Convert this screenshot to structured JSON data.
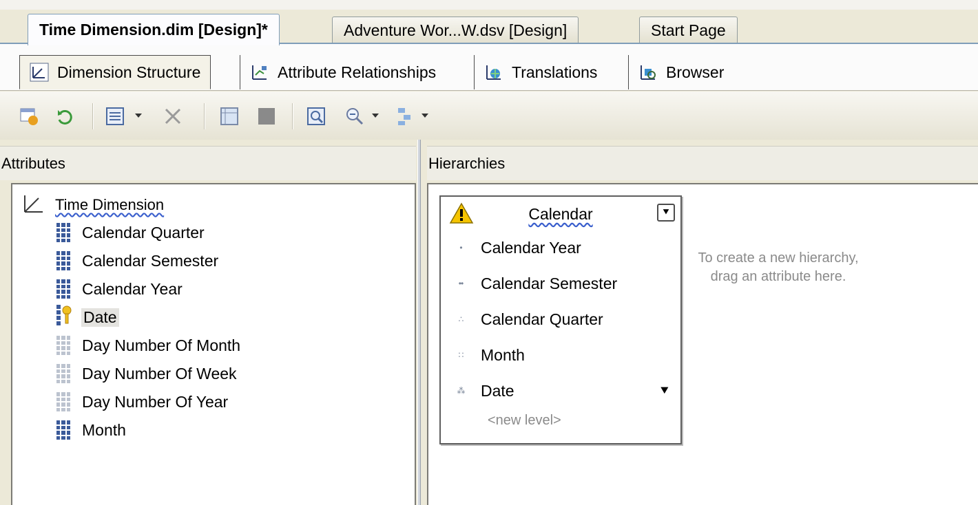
{
  "document_tabs": [
    {
      "label": "Time Dimension.dim [Design]*",
      "active": true
    },
    {
      "label": "Adventure Wor...W.dsv [Design]",
      "active": false
    },
    {
      "label": "Start Page",
      "active": false
    }
  ],
  "designer_tabs": [
    {
      "label": "Dimension Structure",
      "icon": "dimension-structure-icon",
      "active": true
    },
    {
      "label": "Attribute Relationships",
      "icon": "attribute-relationships-icon",
      "active": false
    },
    {
      "label": "Translations",
      "icon": "translations-icon",
      "active": false
    },
    {
      "label": "Browser",
      "icon": "browser-icon",
      "active": false
    }
  ],
  "toolbar": {
    "buttons": [
      "add-table-icon",
      "refresh-icon",
      "show-list-icon",
      "delete-icon",
      "show-grid-icon",
      "stop-icon",
      "zoom-fit-icon",
      "zoom-icon",
      "arrange-icon"
    ]
  },
  "attributes_pane": {
    "title": "Attributes",
    "root": "Time Dimension",
    "items": [
      {
        "label": "Calendar Quarter",
        "icon": "attribute-icon"
      },
      {
        "label": "Calendar Semester",
        "icon": "attribute-icon"
      },
      {
        "label": "Calendar Year",
        "icon": "attribute-icon"
      },
      {
        "label": "Date",
        "icon": "key-attribute-icon",
        "selected": true
      },
      {
        "label": "Day Number Of Month",
        "icon": "disabled-attribute-icon"
      },
      {
        "label": "Day Number Of Week",
        "icon": "disabled-attribute-icon"
      },
      {
        "label": "Day Number Of Year",
        "icon": "disabled-attribute-icon"
      },
      {
        "label": "Month",
        "icon": "attribute-icon"
      }
    ]
  },
  "hierarchies_pane": {
    "title": "Hierarchies",
    "hierarchy": {
      "name": "Calendar",
      "warning": true,
      "levels": [
        {
          "label": "Calendar Year",
          "dots": "•"
        },
        {
          "label": "Calendar Semester",
          "dots": "••"
        },
        {
          "label": "Calendar Quarter",
          "dots": "∴"
        },
        {
          "label": "Month",
          "dots": "∷"
        },
        {
          "label": "Date",
          "dots": "⁂"
        }
      ],
      "new_level": "<new level>"
    },
    "drop_hint": "To create a new hierarchy, drag an attribute here."
  },
  "colors": {
    "attribute_icon": "#3b5a9a",
    "disabled_icon": "#bcc3cf",
    "hint_text": "#8a8a8a",
    "warning": "#f5c400"
  }
}
